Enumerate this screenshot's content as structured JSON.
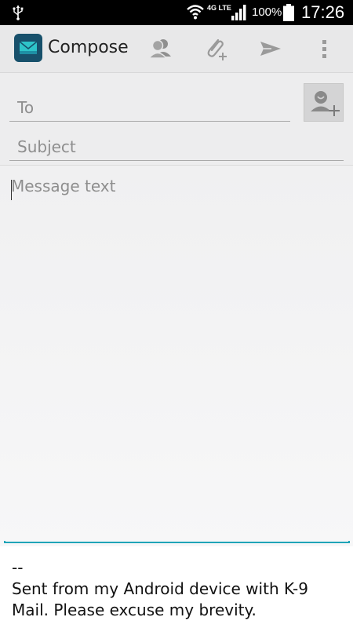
{
  "status_bar": {
    "network_type": "4G LTE",
    "battery_percent": "100%",
    "time": "17:26"
  },
  "action_bar": {
    "title": "Compose",
    "icons": [
      "contacts-icon",
      "attach-icon",
      "send-icon",
      "overflow-menu-icon"
    ]
  },
  "compose": {
    "to_placeholder": "To",
    "subject_placeholder": "Subject",
    "message_placeholder": "Message text",
    "signature": "--\nSent from my Android device with K-9 Mail. Please excuse my brevity."
  },
  "colors": {
    "status_bar_bg": "#000000",
    "action_bar_bg": "#e8e8e9",
    "accent_underline": "#1fa4b8",
    "app_icon_bg": "#17506b",
    "icon_gray": "#9a9a9a"
  }
}
